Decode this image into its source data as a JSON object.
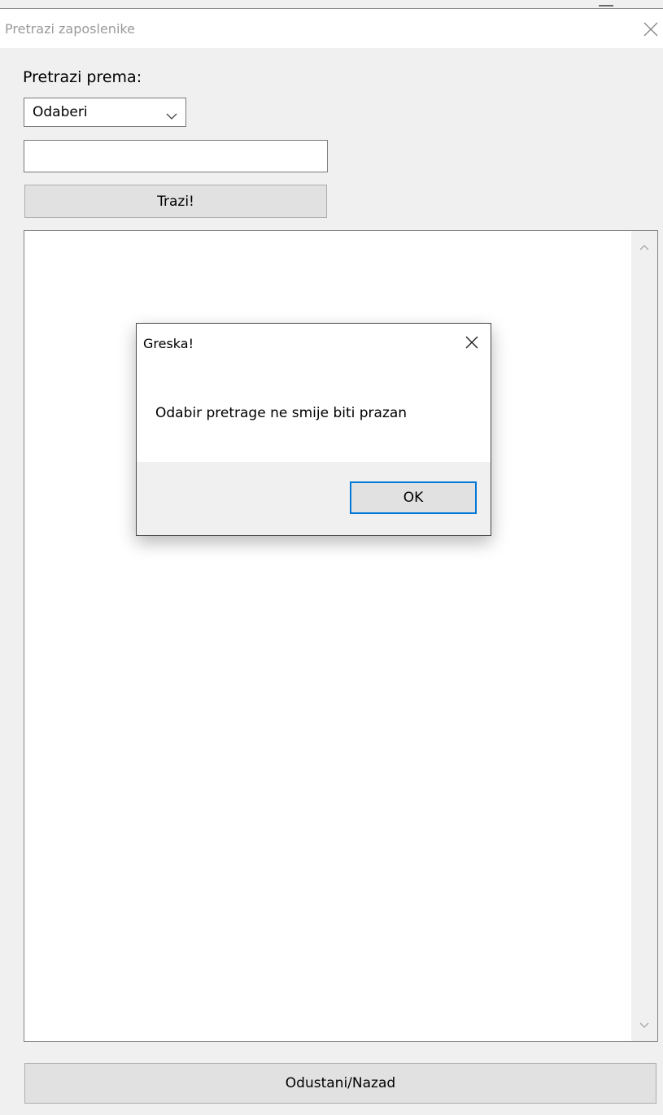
{
  "window": {
    "title": "Pretrazi zaposlenike"
  },
  "form": {
    "search_by_label": "Pretrazi prema:",
    "combo_selected": "Odaberi",
    "search_value": "",
    "search_button_label": "Trazi!",
    "back_button_label": "Odustani/Nazad"
  },
  "dialog": {
    "title": "Greska!",
    "message": "Odabir pretrage ne smije biti prazan",
    "ok_label": "OK"
  },
  "icons": {
    "window_close": "close-icon",
    "dialog_close": "close-icon",
    "combo_arrow": "chevron-down-icon",
    "scroll_up": "chevron-up-icon",
    "scroll_down": "chevron-down-icon"
  },
  "colors": {
    "focus_accent": "#0078d7",
    "window_bg": "#f0f0f0",
    "title_text": "#999999"
  }
}
